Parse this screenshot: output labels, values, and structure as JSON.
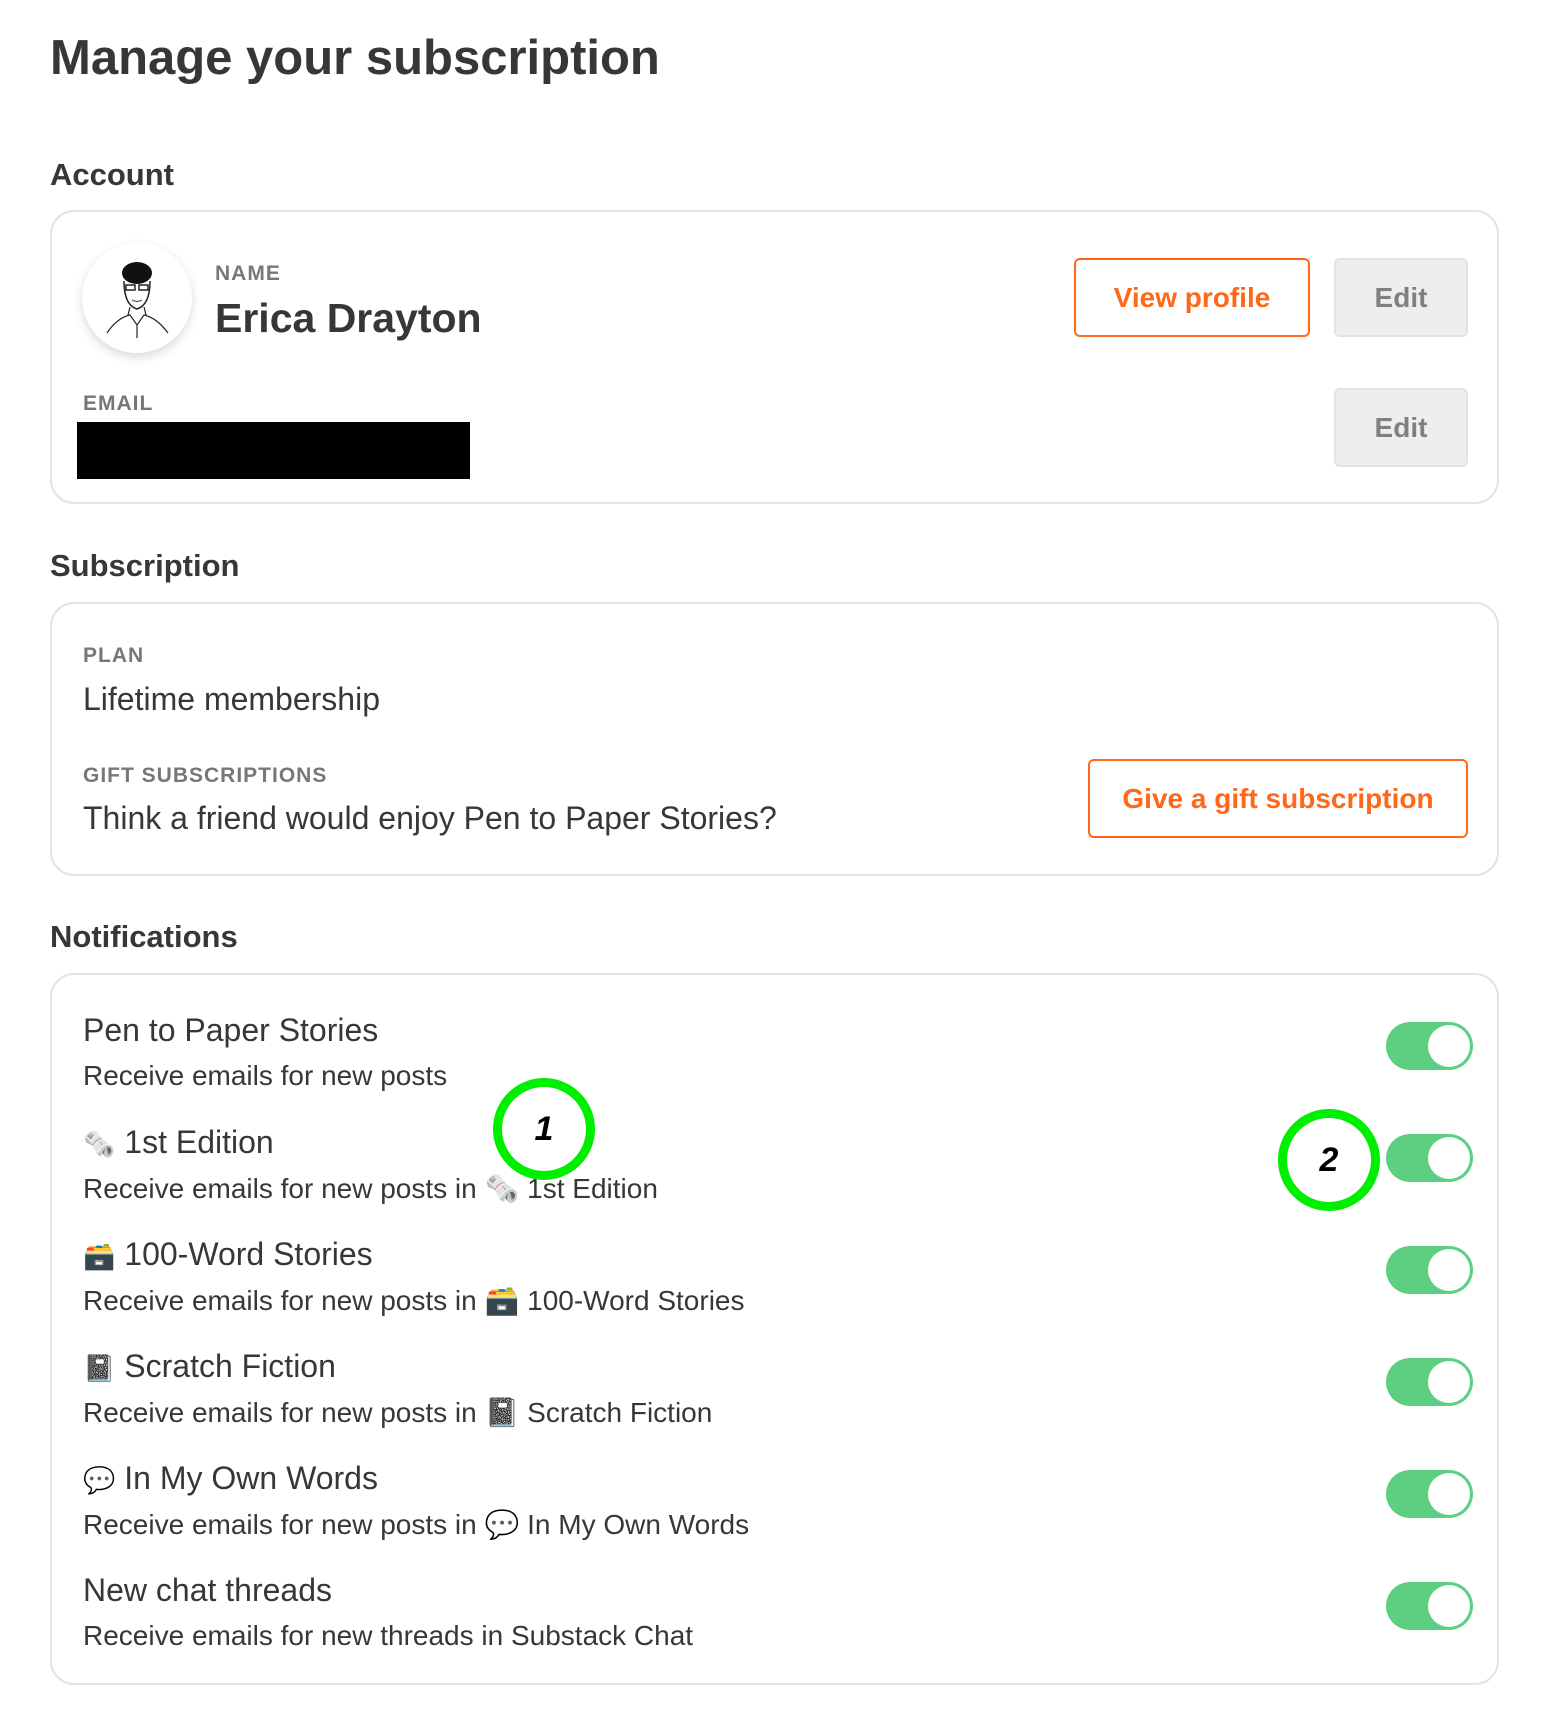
{
  "page_title": "Manage your subscription",
  "account": {
    "heading": "Account",
    "name_label": "NAME",
    "name": "Erica Drayton",
    "view_profile": "View profile",
    "edit_name": "Edit",
    "email_label": "EMAIL",
    "edit_email": "Edit"
  },
  "subscription": {
    "heading": "Subscription",
    "plan_label": "PLAN",
    "plan": "Lifetime membership",
    "gift_label": "GIFT SUBSCRIPTIONS",
    "gift_text": "Think a friend would enjoy Pen to Paper Stories?",
    "gift_button": "Give a gift subscription"
  },
  "notifications": {
    "heading": "Notifications",
    "items": [
      {
        "icon": "",
        "title": "Pen to Paper Stories",
        "subtitle": "Receive emails for new posts",
        "enabled": true
      },
      {
        "icon": "🗞️",
        "title": "1st Edition",
        "subtitle": "Receive emails for new posts in 🗞️ 1st Edition",
        "enabled": true
      },
      {
        "icon": "🗃️",
        "title": "100-Word Stories",
        "subtitle": "Receive emails for new posts in 🗃️ 100-Word Stories",
        "enabled": true
      },
      {
        "icon": "📓",
        "title": "Scratch Fiction",
        "subtitle": "Receive emails for new posts in 📓 Scratch Fiction",
        "enabled": true
      },
      {
        "icon": "💬",
        "title": "In My Own Words",
        "subtitle": "Receive emails for new posts in 💬 In My Own Words",
        "enabled": true
      },
      {
        "icon": "",
        "title": "New chat threads",
        "subtitle": "Receive emails for new threads in Substack Chat",
        "enabled": true
      }
    ]
  },
  "annotations": [
    "1",
    "2"
  ],
  "colors": {
    "accent": "#ff6719",
    "toggle_on": "#5ccf80",
    "annotation": "#00ee00"
  }
}
